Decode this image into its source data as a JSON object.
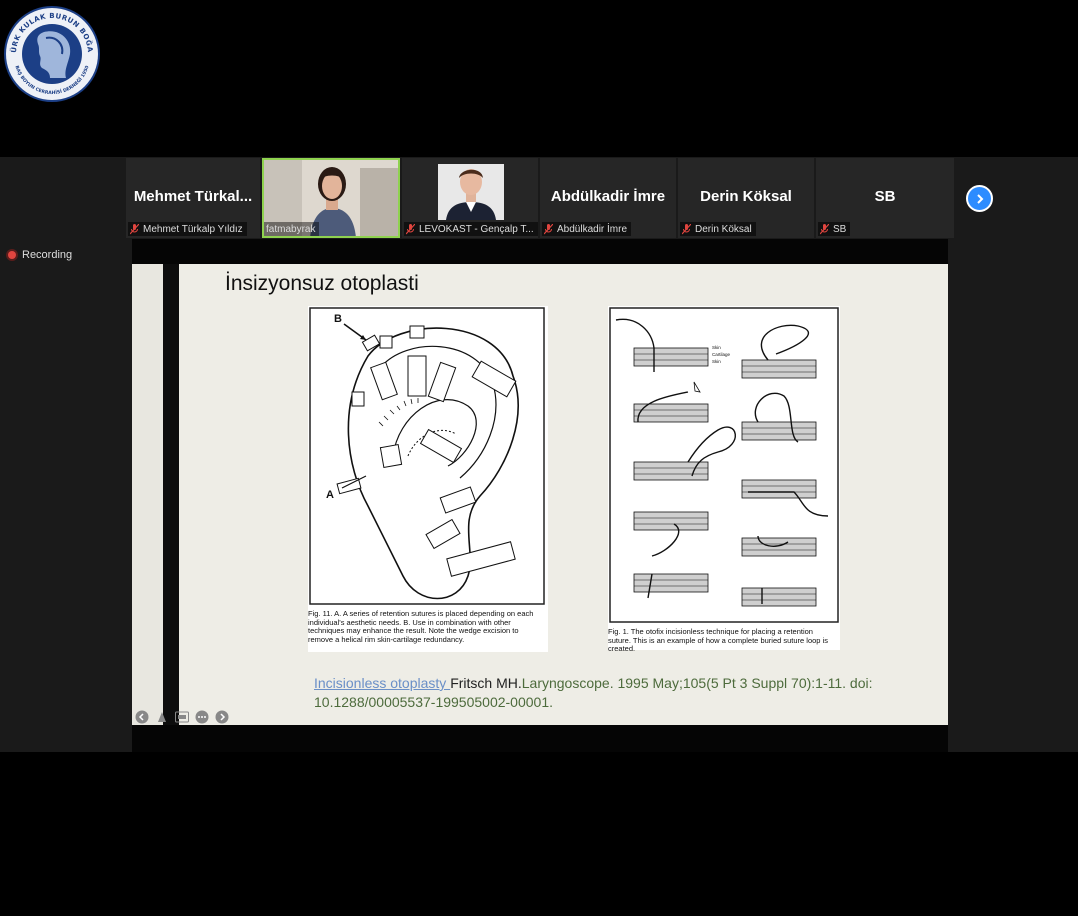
{
  "logo": {
    "text_top": "TÜRK KULAK BURUN BOĞAZ",
    "text_bottom": "BAŞ BOYUN CERRAHİSİ DERNEĞİ 1950"
  },
  "participants": [
    {
      "big": "Mehmet  Türkal...",
      "name": "Mehmet Türkalp Yıldız",
      "muted": true,
      "video": false
    },
    {
      "big": "",
      "name": "fatmabyrak",
      "muted": false,
      "video": true,
      "active": true
    },
    {
      "big": "",
      "name": "LEVOKAST - Gençalp T...",
      "muted": true,
      "video": true
    },
    {
      "big": "Abdülkadir İmre",
      "name": "Abdülkadir İmre",
      "muted": true,
      "video": false
    },
    {
      "big": "Derin Köksal",
      "name": "Derin Köksal",
      "muted": true,
      "video": false
    },
    {
      "big": "SB",
      "name": "SB",
      "muted": true,
      "video": false
    }
  ],
  "recording_label": "Recording",
  "slide": {
    "title": "İnsizyonsuz otoplasti",
    "fig_left": {
      "label_a": "A",
      "label_b": "B",
      "caption": "Fig. 11.  A. A series of retention sutures is placed depending on each individual's aesthetic needs. B. Use in combination with other techniques may enhance the result. Note the wedge excision to remove a helical rim skin-cartilage redundancy."
    },
    "fig_right": {
      "legend_skin": "Skin",
      "legend_cartilage": "Cartilage",
      "legend_skin2": "Skin",
      "caption": "Fig. 1.  The otofix incisionless technique for placing a retention suture. This is an example of how a complete buried suture loop is created."
    },
    "citation": {
      "link_text": "Incisionless otoplasty ",
      "author": "Fritsch MH.",
      "rest": "Laryngoscope. 1995 May;105(5 Pt 3 Suppl 70):1-11. doi: 10.1288/00005537-199505002-00001."
    }
  },
  "colors": {
    "background": "#000000",
    "tile": "#262626",
    "active_border": "#8fd24f",
    "next_button": "#2d8cff",
    "slide_bg": "#eeede6",
    "citation_link": "#6a8fc7",
    "citation_text": "#4d6b3c"
  },
  "icons": {
    "next": "chevron-right-icon",
    "mic_muted": "mic-muted-icon",
    "slide_prev": "arrow-left-icon",
    "slide_pen": "pen-icon",
    "slide_cc": "caption-icon",
    "slide_more": "more-icon",
    "slide_next": "arrow-right-icon"
  }
}
